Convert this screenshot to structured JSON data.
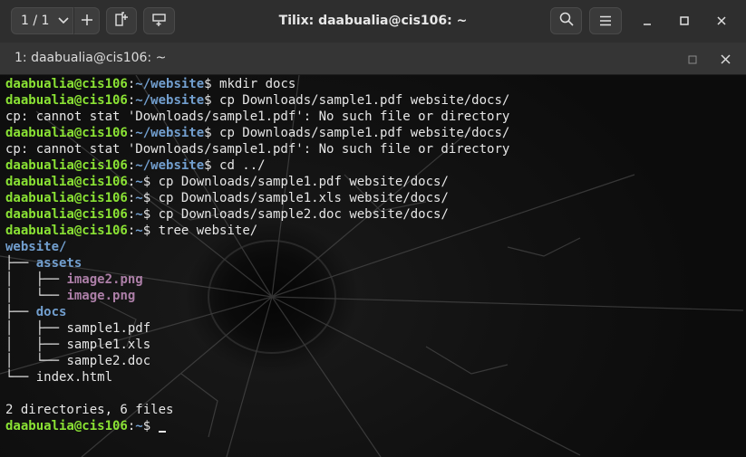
{
  "header": {
    "session_label": "1 / 1",
    "title": "Tilix: daabualia@cis106: ~"
  },
  "tab": {
    "title": "1: daabualia@cis106: ~"
  },
  "terminal": {
    "user_host": "daabualia@cis106",
    "lines": [
      {
        "type": "prompt",
        "path": "~/website",
        "cmd": " mkdir docs"
      },
      {
        "type": "prompt",
        "path": "~/website",
        "cmd": " cp Downloads/sample1.pdf website/docs/"
      },
      {
        "type": "out",
        "text": "cp: cannot stat 'Downloads/sample1.pdf': No such file or directory"
      },
      {
        "type": "prompt",
        "path": "~/website",
        "cmd": " cp Downloads/sample1.pdf website/docs/"
      },
      {
        "type": "out",
        "text": "cp: cannot stat 'Downloads/sample1.pdf': No such file or directory"
      },
      {
        "type": "prompt",
        "path": "~/website",
        "cmd": " cd ../"
      },
      {
        "type": "prompt",
        "path": "~",
        "cmd": " cp Downloads/sample1.pdf website/docs/"
      },
      {
        "type": "prompt",
        "path": "~",
        "cmd": " cp Downloads/sample1.xls website/docs/"
      },
      {
        "type": "prompt",
        "path": "~",
        "cmd": " cp Downloads/sample2.doc website/docs/"
      },
      {
        "type": "prompt",
        "path": "~",
        "cmd": " tree website/"
      },
      {
        "type": "tree",
        "prefix": "",
        "name": "website/",
        "kind": "dir"
      },
      {
        "type": "tree",
        "prefix": "├── ",
        "name": "assets",
        "kind": "dir"
      },
      {
        "type": "tree",
        "prefix": "│   ├── ",
        "name": "image2.png",
        "kind": "img"
      },
      {
        "type": "tree",
        "prefix": "│   └── ",
        "name": "image.png",
        "kind": "img"
      },
      {
        "type": "tree",
        "prefix": "├── ",
        "name": "docs",
        "kind": "dir"
      },
      {
        "type": "tree",
        "prefix": "│   ├── ",
        "name": "sample1.pdf",
        "kind": "file"
      },
      {
        "type": "tree",
        "prefix": "│   ├── ",
        "name": "sample1.xls",
        "kind": "file"
      },
      {
        "type": "tree",
        "prefix": "│   └── ",
        "name": "sample2.doc",
        "kind": "file"
      },
      {
        "type": "tree",
        "prefix": "└── ",
        "name": "index.html",
        "kind": "file"
      },
      {
        "type": "out",
        "text": ""
      },
      {
        "type": "out",
        "text": "2 directories, 6 files"
      },
      {
        "type": "prompt",
        "path": "~",
        "cmd": " ",
        "cursor": true
      }
    ]
  },
  "icons": [
    "chevron-down-icon",
    "plus-icon",
    "add-terminal-right-icon",
    "add-terminal-down-icon",
    "search-icon",
    "hamburger-menu-icon",
    "minimize-icon",
    "maximize-icon",
    "close-icon",
    "tab-maximize-icon",
    "tab-close-icon"
  ],
  "colors": {
    "user_host": "#8ae234",
    "path": "#729fcf",
    "directory": "#729fcf",
    "image_file": "#ad7fa8",
    "text": "#e6e6e6"
  }
}
